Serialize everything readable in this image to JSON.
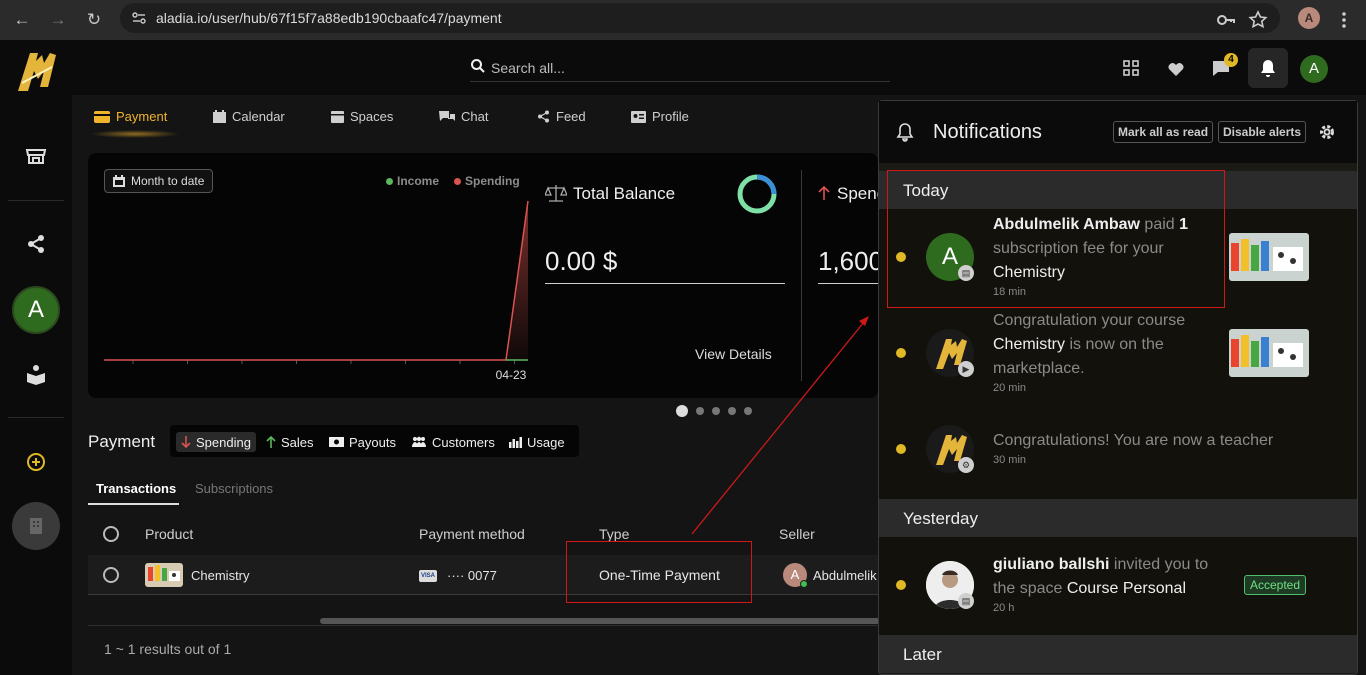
{
  "browser": {
    "url": "aladia.io/user/hub/67f15f7a88edb190cbaafc47/payment",
    "profile_initial": "A"
  },
  "search": {
    "placeholder": "Search all..."
  },
  "header": {
    "messages_badge": "4",
    "avatar_initial": "A"
  },
  "sidebar": {
    "avatar_initial": "A"
  },
  "tabs": [
    {
      "label": "Payment",
      "icon": "card-icon"
    },
    {
      "label": "Calendar",
      "icon": "calendar-icon"
    },
    {
      "label": "Spaces",
      "icon": "spaces-icon"
    },
    {
      "label": "Chat",
      "icon": "chat-icon"
    },
    {
      "label": "Feed",
      "icon": "share-icon"
    },
    {
      "label": "Profile",
      "icon": "profile-icon"
    }
  ],
  "overview": {
    "range_button": "Month to date",
    "legend": {
      "income": "Income",
      "spending": "Spending"
    },
    "x_tick": "04-23",
    "total_balance": {
      "title": "Total Balance",
      "value": "0.00 $",
      "link": "View Details"
    },
    "spending": {
      "title": "Spend",
      "value": "1,600"
    },
    "colors": {
      "income": "#5cb85c",
      "spending": "#d9534f",
      "accent": "#f0b42b"
    }
  },
  "chart_data": {
    "type": "line",
    "x": [
      "04-23"
    ],
    "series": [
      {
        "name": "Income",
        "values": [
          0
        ]
      },
      {
        "name": "Spending",
        "values": [
          1600
        ]
      }
    ]
  },
  "payment": {
    "title": "Payment",
    "tabs": [
      "Spending",
      "Sales",
      "Payouts",
      "Customers",
      "Usage"
    ],
    "subtabs": [
      "Transactions",
      "Subscriptions"
    ],
    "columns": [
      "Product",
      "Payment method",
      "Type",
      "Seller"
    ],
    "rows": [
      {
        "product": "Chemistry",
        "card": "···· 0077",
        "type": "One-Time Payment",
        "seller": "Abdulmelik",
        "seller_initial": "A"
      }
    ],
    "results": "1 ~ 1 results out of 1"
  },
  "notifications": {
    "title": "Notifications",
    "mark_all": "Mark all as read",
    "disable": "Disable alerts",
    "sections": {
      "today": "Today",
      "yesterday": "Yesterday",
      "later": "Later"
    },
    "items": [
      {
        "name": "Abdulmelik Ambaw",
        "t1": " paid ",
        "count": "1",
        "t2": " subscription fee for your ",
        "course": "Chemistry",
        "time": "18 min",
        "initial": "A"
      },
      {
        "t1": "Congratulation your course ",
        "course": "Chemistry",
        "t2": " is now on the marketplace.",
        "time": "20 min"
      },
      {
        "t1": "Congratulations! You are now a teacher",
        "time": "30 min"
      },
      {
        "name": "giuliano ballshi",
        "t1": " invited you to the space ",
        "space": "Course Personal",
        "time": "20 h",
        "status": "Accepted"
      }
    ]
  }
}
